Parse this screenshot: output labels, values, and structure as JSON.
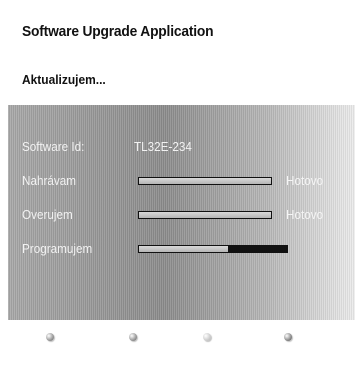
{
  "app": {
    "title": "Software Upgrade Application",
    "subtitle": "Aktualizujem..."
  },
  "info": {
    "software_id_label": "Software Id:",
    "software_id_value": "TL32E-234"
  },
  "steps": [
    {
      "label": "Nahrávam",
      "progress": 1.0,
      "status": "Hotovo"
    },
    {
      "label": "Overujem",
      "progress": 1.0,
      "status": "Hotovo"
    },
    {
      "label": "Programujem",
      "progress": 0.6,
      "status": ""
    }
  ],
  "color_buttons": [
    {
      "name": "red-button",
      "color": "#777777"
    },
    {
      "name": "green-button",
      "color": "#777777"
    },
    {
      "name": "yellow-button",
      "color": "#bbbbbb"
    },
    {
      "name": "blue-button",
      "color": "#666666"
    }
  ]
}
